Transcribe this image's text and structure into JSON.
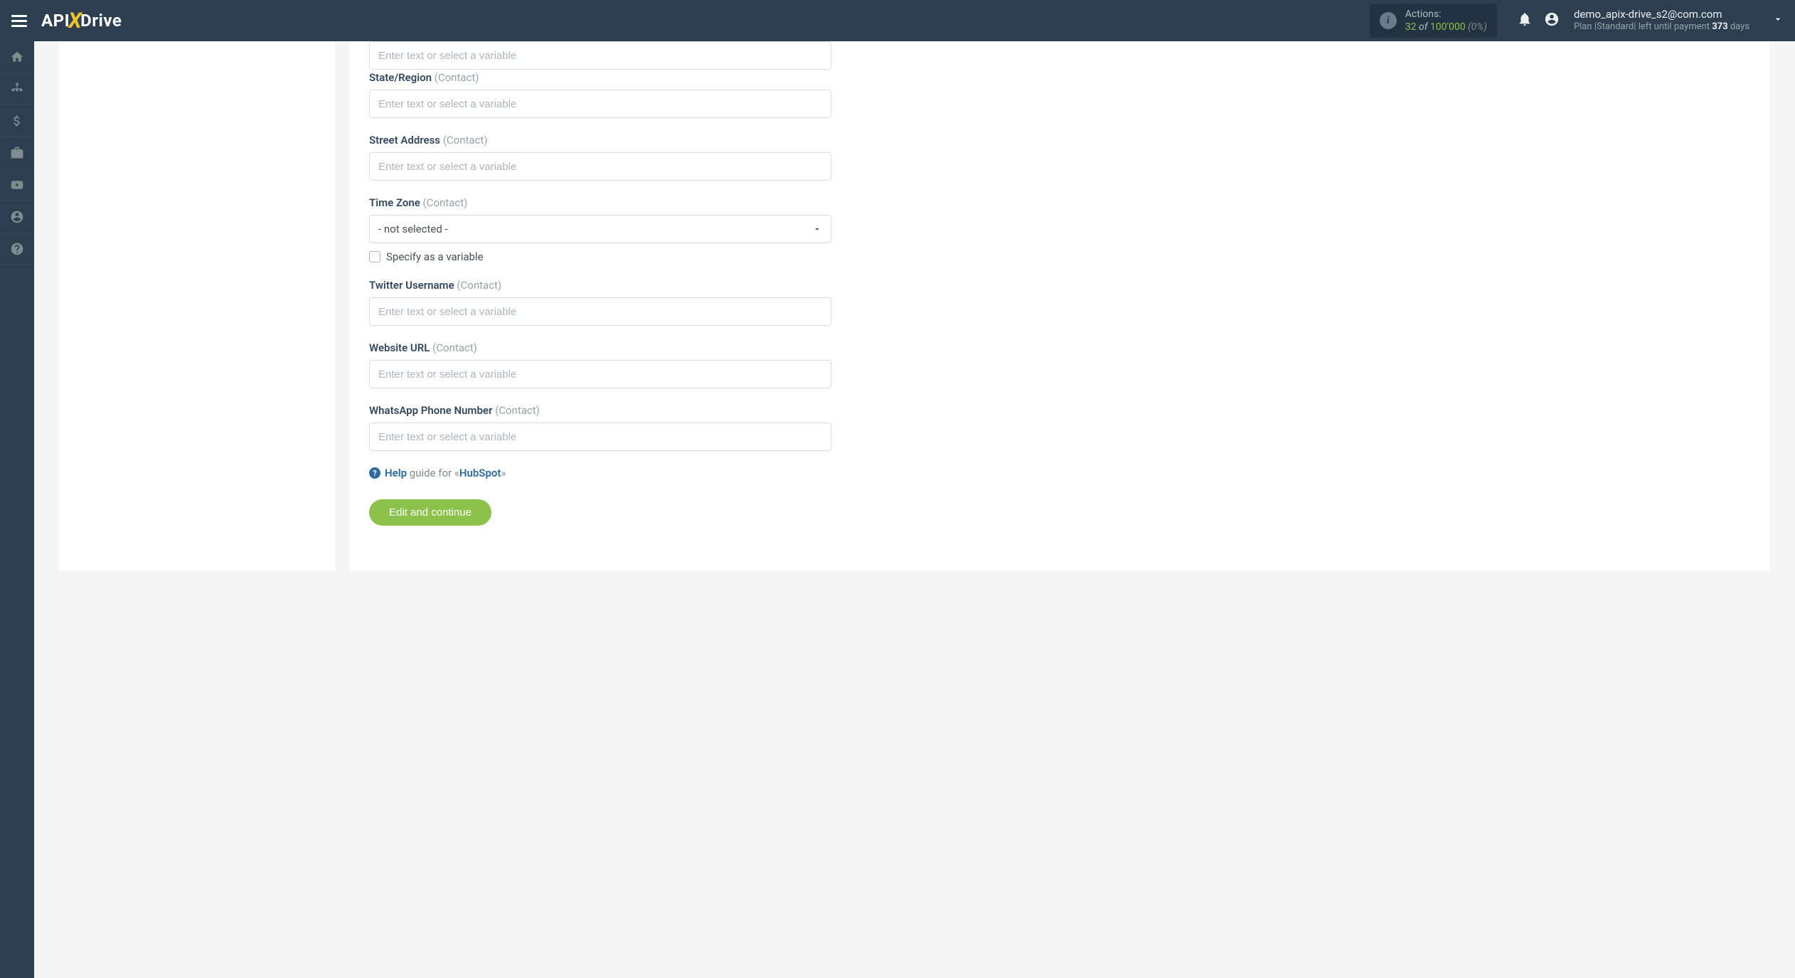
{
  "header": {
    "logo_api": "API",
    "logo_x": "X",
    "logo_drive": "Drive",
    "actions_label": "Actions:",
    "actions_count": "32",
    "actions_of": " of ",
    "actions_max": "100'000",
    "actions_pct": " (0%)",
    "user_email": "demo_apix-drive_s2@com.com",
    "plan_prefix": "Plan |Standard| left until payment ",
    "plan_days": "373",
    "plan_suffix": " days"
  },
  "form": {
    "placeholder": "Enter text or select a variable",
    "fields": [
      {
        "label": "State/Region",
        "sub": "(Contact)",
        "type": "text"
      },
      {
        "label": "Street Address",
        "sub": "(Contact)",
        "type": "text"
      },
      {
        "label": "Time Zone",
        "sub": "(Contact)",
        "type": "select",
        "selected": "- not selected -",
        "checkbox_label": "Specify as a variable"
      },
      {
        "label": "Twitter Username",
        "sub": "(Contact)",
        "type": "text"
      },
      {
        "label": "Website URL",
        "sub": "(Contact)",
        "type": "text"
      },
      {
        "label": "WhatsApp Phone Number",
        "sub": "(Contact)",
        "type": "text"
      }
    ],
    "help_word": "Help",
    "help_rest": "guide for «",
    "help_system": "HubSpot",
    "help_close": "»",
    "button_label": "Edit and continue"
  }
}
